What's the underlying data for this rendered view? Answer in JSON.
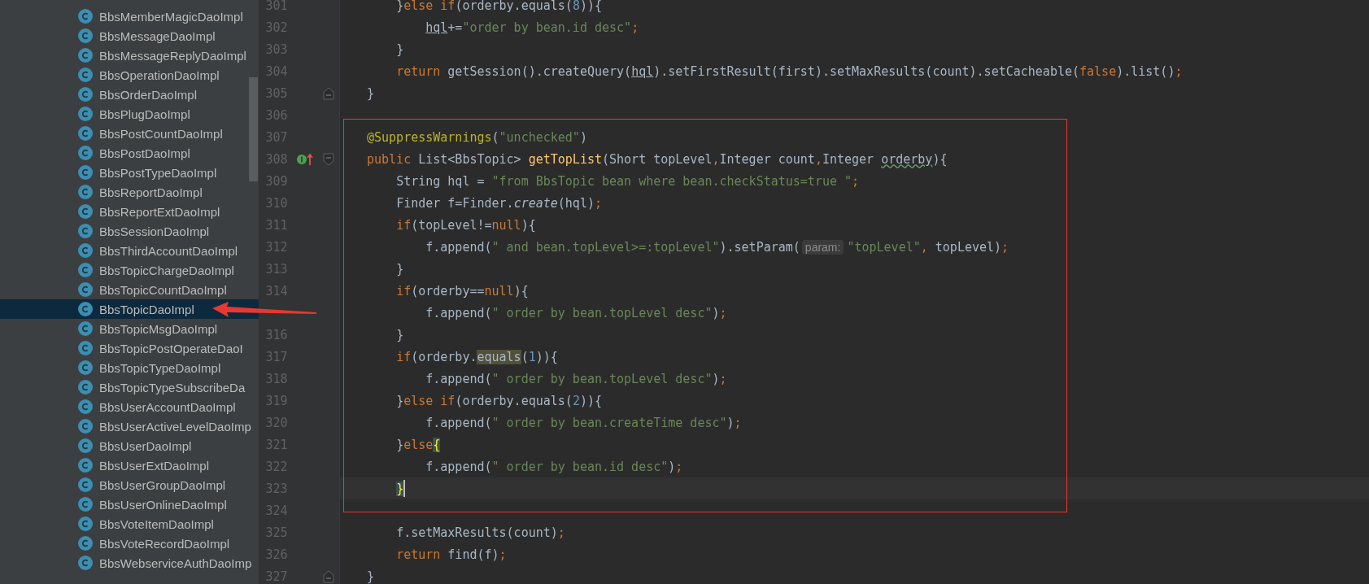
{
  "project_tree": {
    "items": [
      {
        "label": "BbsMemberMagicDaoImpl",
        "selected": false
      },
      {
        "label": "BbsMessageDaoImpl",
        "selected": false
      },
      {
        "label": "BbsMessageReplyDaoImpl",
        "selected": false
      },
      {
        "label": "BbsOperationDaoImpl",
        "selected": false
      },
      {
        "label": "BbsOrderDaoImpl",
        "selected": false
      },
      {
        "label": "BbsPlugDaoImpl",
        "selected": false
      },
      {
        "label": "BbsPostCountDaoImpl",
        "selected": false
      },
      {
        "label": "BbsPostDaoImpl",
        "selected": false
      },
      {
        "label": "BbsPostTypeDaoImpl",
        "selected": false
      },
      {
        "label": "BbsReportDaoImpl",
        "selected": false
      },
      {
        "label": "BbsReportExtDaoImpl",
        "selected": false
      },
      {
        "label": "BbsSessionDaoImpl",
        "selected": false
      },
      {
        "label": "BbsThirdAccountDaoImpl",
        "selected": false
      },
      {
        "label": "BbsTopicChargeDaoImpl",
        "selected": false
      },
      {
        "label": "BbsTopicCountDaoImpl",
        "selected": false
      },
      {
        "label": "BbsTopicDaoImpl",
        "selected": true
      },
      {
        "label": "BbsTopicMsgDaoImpl",
        "selected": false
      },
      {
        "label": "BbsTopicPostOperateDaoI",
        "selected": false
      },
      {
        "label": "BbsTopicTypeDaoImpl",
        "selected": false
      },
      {
        "label": "BbsTopicTypeSubscribeDa",
        "selected": false
      },
      {
        "label": "BbsUserAccountDaoImpl",
        "selected": false
      },
      {
        "label": "BbsUserActiveLevelDaoImp",
        "selected": false
      },
      {
        "label": "BbsUserDaoImpl",
        "selected": false
      },
      {
        "label": "BbsUserExtDaoImpl",
        "selected": false
      },
      {
        "label": "BbsUserGroupDaoImpl",
        "selected": false
      },
      {
        "label": "BbsUserOnlineDaoImpl",
        "selected": false
      },
      {
        "label": "BbsVoteItemDaoImpl",
        "selected": false
      },
      {
        "label": "BbsVoteRecordDaoImpl",
        "selected": false
      },
      {
        "label": "BbsWebserviceAuthDaoImp",
        "selected": false
      }
    ]
  },
  "editor": {
    "lines": [
      {
        "number": "301",
        "tokens": [
          {
            "kind": "plain",
            "text": "    }"
          },
          {
            "kind": "keyword",
            "text": "else if"
          },
          {
            "kind": "plain",
            "text": "(orderby.equals("
          },
          {
            "kind": "number",
            "text": "8"
          },
          {
            "kind": "plain",
            "text": ")){"
          }
        ]
      },
      {
        "number": "302",
        "tokens": [
          {
            "kind": "underline",
            "text": "        hql"
          },
          {
            "kind": "plain",
            "text": "+="
          },
          {
            "kind": "string",
            "text": "\"order by bean.id desc\""
          },
          {
            "kind": "keyword",
            "text": ";"
          }
        ]
      },
      {
        "number": "303",
        "tokens": [
          {
            "kind": "plain",
            "text": "    }"
          }
        ]
      },
      {
        "number": "304",
        "tokens": [
          {
            "kind": "keyword",
            "text": "    return"
          },
          {
            "kind": "plain",
            "text": " getSession().createQuery("
          },
          {
            "kind": "underline",
            "text": "hql"
          },
          {
            "kind": "plain",
            "text": ").setFirstResult(first).setMaxResults(count).setCacheable("
          },
          {
            "kind": "keyword",
            "text": "false"
          },
          {
            "kind": "plain",
            "text": ").list()"
          },
          {
            "kind": "keyword",
            "text": ";"
          }
        ]
      },
      {
        "number": "305",
        "fold_end": true,
        "tokens": [
          {
            "kind": "plain",
            "text": "}"
          }
        ]
      },
      {
        "number": "306"
      },
      {
        "number": "307",
        "tokens": [
          {
            "kind": "annotation",
            "text": "@SuppressWarnings"
          },
          {
            "kind": "plain",
            "text": "("
          },
          {
            "kind": "string",
            "text": "\"unchecked\""
          },
          {
            "kind": "plain",
            "text": ")"
          }
        ]
      },
      {
        "number": "308",
        "fold_start": true,
        "override_marker": true,
        "tokens": [
          {
            "kind": "keyword",
            "text": "public"
          },
          {
            "kind": "plain",
            "text": " List<BbsTopic> "
          },
          {
            "kind": "method",
            "text": "getTopList"
          },
          {
            "kind": "plain",
            "text": "(Short topLevel"
          },
          {
            "kind": "keyword",
            "text": ","
          },
          {
            "kind": "plain",
            "text": "Integer count"
          },
          {
            "kind": "keyword",
            "text": ","
          },
          {
            "kind": "plain",
            "text": "Integer "
          },
          {
            "kind": "typo",
            "text": "orderby"
          },
          {
            "kind": "plain",
            "text": "){"
          }
        ]
      },
      {
        "number": "309",
        "tokens": [
          {
            "kind": "plain",
            "text": "    String hql = "
          },
          {
            "kind": "string",
            "text": "\"from BbsTopic bean where bean.checkStatus=true \""
          },
          {
            "kind": "keyword",
            "text": ";"
          }
        ]
      },
      {
        "number": "310",
        "tokens": [
          {
            "kind": "plain",
            "text": "    Finder f=Finder."
          },
          {
            "kind": "italic",
            "text": "create"
          },
          {
            "kind": "plain",
            "text": "(hql)"
          },
          {
            "kind": "keyword",
            "text": ";"
          }
        ]
      },
      {
        "number": "311",
        "tokens": [
          {
            "kind": "keyword",
            "text": "    if"
          },
          {
            "kind": "plain",
            "text": "(topLevel!="
          },
          {
            "kind": "keyword",
            "text": "null"
          },
          {
            "kind": "plain",
            "text": "){"
          }
        ]
      },
      {
        "number": "312",
        "tokens": [
          {
            "kind": "plain",
            "text": "        f.append("
          },
          {
            "kind": "string",
            "text": "\" and bean.topLevel>=:topLevel\""
          },
          {
            "kind": "plain",
            "text": ").setParam("
          },
          {
            "kind": "hint",
            "text": "param:"
          },
          {
            "kind": "string",
            "text": "\"topLevel\""
          },
          {
            "kind": "keyword",
            "text": ","
          },
          {
            "kind": "plain",
            "text": " topLevel)"
          },
          {
            "kind": "keyword",
            "text": ";"
          }
        ]
      },
      {
        "number": "313",
        "tokens": [
          {
            "kind": "plain",
            "text": "    }"
          }
        ]
      },
      {
        "number": "314",
        "tokens": [
          {
            "kind": "keyword",
            "text": "    if"
          },
          {
            "kind": "plain",
            "text": "(orderby=="
          },
          {
            "kind": "keyword",
            "text": "null"
          },
          {
            "kind": "plain",
            "text": "){"
          }
        ]
      },
      {
        "tokens": [
          {
            "kind": "plain",
            "text": "        f.append("
          },
          {
            "kind": "string",
            "text": "\" order by bean.topLevel desc\""
          },
          {
            "kind": "plain",
            "text": ")"
          },
          {
            "kind": "keyword",
            "text": ";"
          }
        ]
      },
      {
        "number": "316",
        "tokens": [
          {
            "kind": "plain",
            "text": "    }"
          }
        ]
      },
      {
        "number": "317",
        "tokens": [
          {
            "kind": "keyword",
            "text": "    if"
          },
          {
            "kind": "plain",
            "text": "(orderby."
          },
          {
            "kind": "highlight",
            "text": "equals"
          },
          {
            "kind": "plain",
            "text": "("
          },
          {
            "kind": "number",
            "text": "1"
          },
          {
            "kind": "plain",
            "text": ")){"
          }
        ]
      },
      {
        "number": "318",
        "tokens": [
          {
            "kind": "plain",
            "text": "        f.append("
          },
          {
            "kind": "string",
            "text": "\" order by bean.topLevel desc\""
          },
          {
            "kind": "plain",
            "text": ")"
          },
          {
            "kind": "keyword",
            "text": ";"
          }
        ]
      },
      {
        "number": "319",
        "tokens": [
          {
            "kind": "plain",
            "text": "    }"
          },
          {
            "kind": "keyword",
            "text": "else if"
          },
          {
            "kind": "plain",
            "text": "(orderby.equals("
          },
          {
            "kind": "number",
            "text": "2"
          },
          {
            "kind": "plain",
            "text": ")){"
          }
        ]
      },
      {
        "number": "320",
        "tokens": [
          {
            "kind": "plain",
            "text": "        f.append("
          },
          {
            "kind": "string",
            "text": "\" order by bean.createTime desc\""
          },
          {
            "kind": "plain",
            "text": ")"
          },
          {
            "kind": "keyword",
            "text": ";"
          }
        ]
      },
      {
        "number": "321",
        "tokens": [
          {
            "kind": "plain",
            "text": "    }"
          },
          {
            "kind": "keyword",
            "text": "else"
          },
          {
            "kind": "brace",
            "text": "{"
          }
        ]
      },
      {
        "number": "322",
        "tokens": [
          {
            "kind": "plain",
            "text": "        f.append("
          },
          {
            "kind": "string",
            "text": "\" order by bean.id desc\""
          },
          {
            "kind": "plain",
            "text": ")"
          },
          {
            "kind": "keyword",
            "text": ";"
          }
        ]
      },
      {
        "number": "323",
        "current": true,
        "cursor": true,
        "tokens": [
          {
            "kind": "brace",
            "text": "    }"
          }
        ]
      },
      {
        "number": "324"
      },
      {
        "number": "325",
        "tokens": [
          {
            "kind": "plain",
            "text": "    f.setMaxResults(count)"
          },
          {
            "kind": "keyword",
            "text": ";"
          }
        ]
      },
      {
        "number": "326",
        "tokens": [
          {
            "kind": "keyword",
            "text": "    return"
          },
          {
            "kind": "plain",
            "text": " find(f)"
          },
          {
            "kind": "keyword",
            "text": ";"
          }
        ]
      },
      {
        "number": "327",
        "fold_end": true,
        "tokens": [
          {
            "kind": "plain",
            "text": "}"
          }
        ]
      }
    ]
  },
  "annotations": {
    "frame": true,
    "arrow": true
  }
}
